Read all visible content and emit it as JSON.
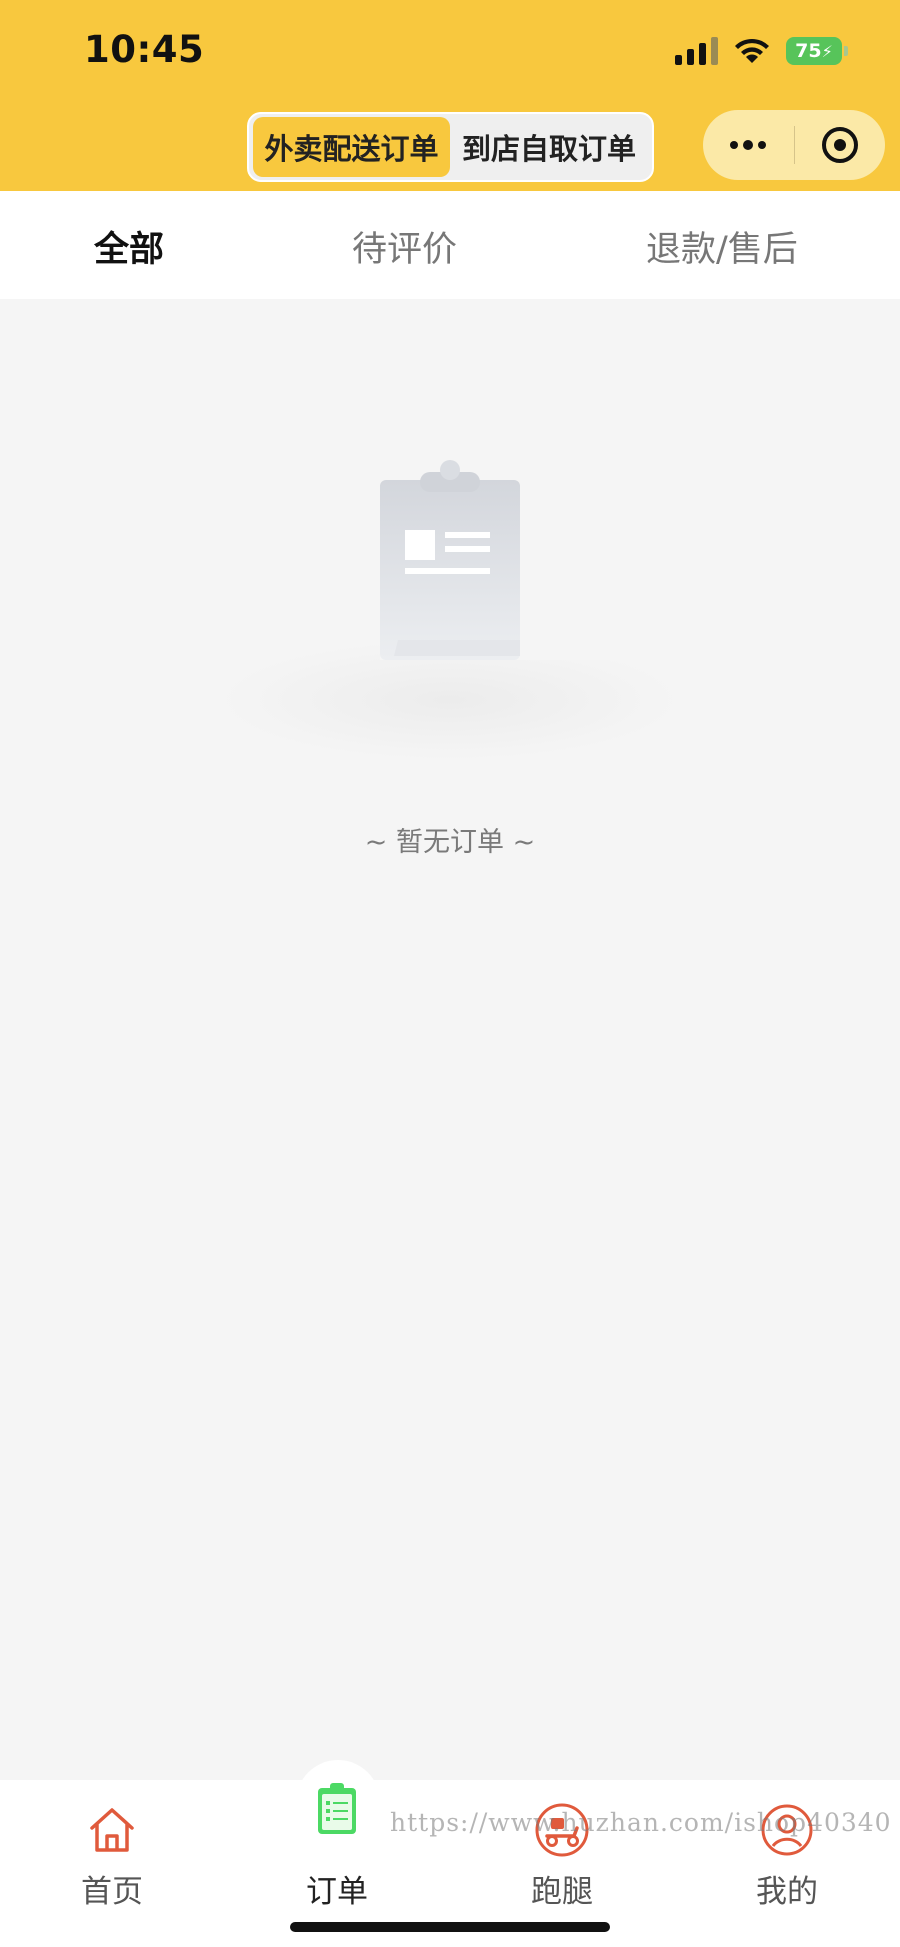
{
  "status_bar": {
    "time": "10:45",
    "battery": "75"
  },
  "segment": {
    "items": [
      "外卖配送订单",
      "到店自取订单"
    ],
    "active_index": 0
  },
  "tabs": [
    "全部",
    "待评价",
    "退款/售后"
  ],
  "empty": {
    "message": "~ 暂无订单 ~"
  },
  "tabbar": {
    "items": [
      "首页",
      "订单",
      "跑腿",
      "我的"
    ],
    "active_index": 1
  },
  "watermark": "https://www.huzhan.com/ishop40340",
  "colors": {
    "brand": "#f8c83e",
    "active_icon": "#4cd964",
    "icon_red": "#e05a3c"
  }
}
